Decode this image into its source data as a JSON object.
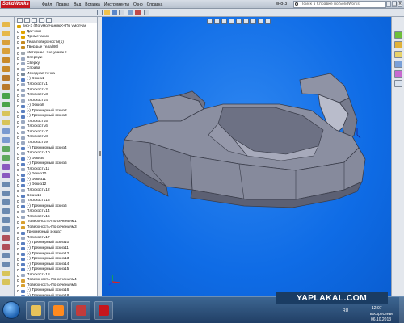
{
  "app": {
    "logo_text": "SolidWorks",
    "document_title": "вно-3",
    "menu": [
      "Файл",
      "Правка",
      "Вид",
      "Вставка",
      "Инструменты",
      "Окно",
      "Справка"
    ],
    "search_placeholder": "Поиск в Справке по SolidWorks"
  },
  "window_buttons": [
    "_",
    "□",
    "×"
  ],
  "feature_tree": {
    "items": [
      {
        "label": "вно-3  (По умолчанию<<По умолчан",
        "root": true,
        "color": "#d9a300"
      },
      {
        "label": "Датчики",
        "color": "#e0a400"
      },
      {
        "label": "Примечания",
        "color": "#e0a400"
      },
      {
        "label": "Тела поверхности(1)",
        "color": "#c58a20"
      },
      {
        "label": "Твердые тела(86)",
        "color": "#c58a20"
      },
      {
        "label": "Материал <не указан>",
        "color": "#a0a8b0"
      },
      {
        "label": "Спереди",
        "color": "#9aa8c0"
      },
      {
        "label": "Сверху",
        "color": "#9aa8c0"
      },
      {
        "label": "Справа",
        "color": "#9aa8c0"
      },
      {
        "label": "Исходная точка",
        "color": "#7a8a9a"
      },
      {
        "label": "(-) Эскиз1",
        "color": "#5a7fc0"
      },
      {
        "label": "Плоскость1",
        "color": "#9aa8c0"
      },
      {
        "label": "Плоскость2",
        "color": "#9aa8c0"
      },
      {
        "label": "Плоскость3",
        "color": "#9aa8c0"
      },
      {
        "label": "Плоскость4",
        "color": "#9aa8c0"
      },
      {
        "label": "(-) Эскиз8",
        "color": "#5a7fc0"
      },
      {
        "label": "(-) Трехмерный эскиз2",
        "color": "#5a7fc0"
      },
      {
        "label": "(-) Трехмерный эскиз3",
        "color": "#5a7fc0"
      },
      {
        "label": "Плоскость5",
        "color": "#9aa8c0"
      },
      {
        "label": "Плоскость6",
        "color": "#9aa8c0"
      },
      {
        "label": "Плоскость7",
        "color": "#9aa8c0"
      },
      {
        "label": "Плоскость8",
        "color": "#9aa8c0"
      },
      {
        "label": "Плоскость9",
        "color": "#9aa8c0"
      },
      {
        "label": "(-) Трехмерный эскиз4",
        "color": "#5a7fc0"
      },
      {
        "label": "Плоскость10",
        "color": "#9aa8c0"
      },
      {
        "label": "(-) Эскиз9",
        "color": "#5a7fc0"
      },
      {
        "label": "(-) Трехмерный эскиз5",
        "color": "#5a7fc0"
      },
      {
        "label": "Плоскость11",
        "color": "#9aa8c0"
      },
      {
        "label": "(-) Эскиз10",
        "color": "#5a7fc0"
      },
      {
        "label": "(-) Эскиз11",
        "color": "#5a7fc0"
      },
      {
        "label": "(-) Эскиз12",
        "color": "#5a7fc0"
      },
      {
        "label": "Плоскость12",
        "color": "#9aa8c0"
      },
      {
        "label": "Эскиз16",
        "color": "#5a7fc0"
      },
      {
        "label": "Плоскость13",
        "color": "#9aa8c0"
      },
      {
        "label": "(-) Трехмерный эскиз6",
        "color": "#5a7fc0"
      },
      {
        "label": "Плоскость14",
        "color": "#9aa8c0"
      },
      {
        "label": "Плоскость15",
        "color": "#9aa8c0"
      },
      {
        "label": "Поверхность-По сечениям1",
        "color": "#d8a030"
      },
      {
        "label": "Поверхность-По сечениям3",
        "color": "#d8a030"
      },
      {
        "label": "Трехмерный эскиз7",
        "color": "#5a7fc0"
      },
      {
        "label": "Плоскость17",
        "color": "#9aa8c0"
      },
      {
        "label": "(-) Трехмерный эскиз10",
        "color": "#5a7fc0"
      },
      {
        "label": "(-) Трехмерный эскиз11",
        "color": "#5a7fc0"
      },
      {
        "label": "(-) Трехмерный эскиз12",
        "color": "#5a7fc0"
      },
      {
        "label": "(-) Трехмерный эскиз13",
        "color": "#5a7fc0"
      },
      {
        "label": "(-) Трехмерный эскиз14",
        "color": "#5a7fc0"
      },
      {
        "label": "(-) Трехмерный эскиз15",
        "color": "#5a7fc0"
      },
      {
        "label": "Плоскость18",
        "color": "#9aa8c0"
      },
      {
        "label": "Поверхность-По сечениям4",
        "color": "#d8a030"
      },
      {
        "label": "Поверхность-По сечениям5",
        "color": "#d8a030"
      },
      {
        "label": "(-) Трехмерный эскиз16",
        "color": "#5a7fc0"
      },
      {
        "label": "(-) Трехмерный эскиз18",
        "color": "#5a7fc0"
      },
      {
        "label": "(-) Трехмерный эскиз19",
        "color": "#5a7fc0"
      },
      {
        "label": "Плоскость19",
        "color": "#9aa8c0"
      },
      {
        "label": "Поверхность-По сечениям6",
        "color": "#d8a030"
      }
    ]
  },
  "viewport": {
    "background": "#1a72e8",
    "model_color": "#7d8193"
  },
  "taskbar": {
    "apps": [
      {
        "name": "explorer-app",
        "color": "#e8c25a"
      },
      {
        "name": "media-player-app",
        "color": "#ff8a1e"
      },
      {
        "name": "archiver-app",
        "color": "#c23b3b"
      },
      {
        "name": "solidworks-app",
        "color": "#c6161d"
      }
    ],
    "watermark": "YAPLAKAL.COM",
    "language": "RU",
    "time": "12:07",
    "weekday": "воскресенье",
    "date": "06.10.2013"
  }
}
